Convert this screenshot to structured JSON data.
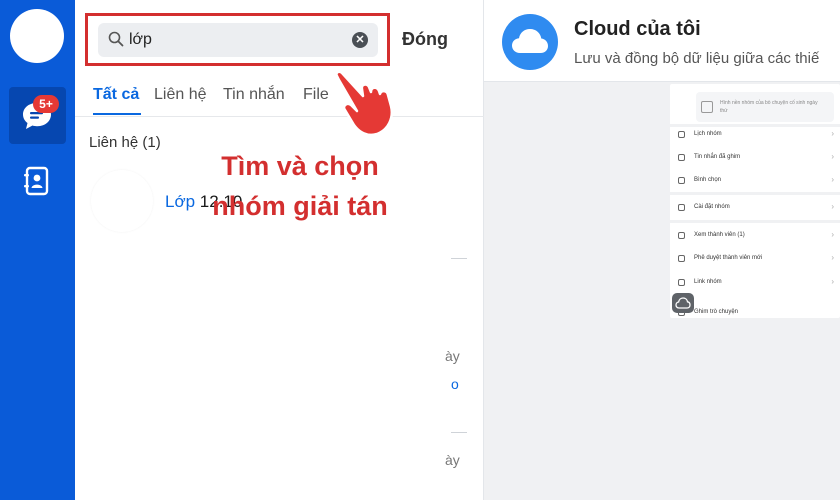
{
  "rail": {
    "chat_badge": "5+"
  },
  "search": {
    "value": "lớp",
    "placeholder": ""
  },
  "header": {
    "close_label": "Đóng"
  },
  "tabs": [
    {
      "label": "Tất cả",
      "active": true
    },
    {
      "label": "Liên hệ",
      "active": false
    },
    {
      "label": "Tin nhắn",
      "active": false
    },
    {
      "label": "File",
      "active": false
    }
  ],
  "results": {
    "section_title": "Liên hệ (1)",
    "item": {
      "name_highlight": "Lớp",
      "name_rest": " 12.10"
    }
  },
  "ghost_text": {
    "line1": "ày",
    "line2": "o",
    "line3": "ày"
  },
  "annotation": {
    "line1": "Tìm và chọn",
    "line2": "nhóm giải tán"
  },
  "cloud": {
    "title": "Cloud của tôi",
    "subtitle": "Lưu và đồng bộ dữ liệu giữa các thiế"
  },
  "phone": {
    "note_text": "Hình nền nhóm của bò chuyện cố sinh ngày thứ",
    "rows": [
      "Lịch nhóm",
      "Tin nhắn đã ghim",
      "Bình chọn",
      "Cài đặt nhóm",
      "Xem thành viên (1)",
      "Phê duyệt thành viên mới",
      "Link nhóm",
      "Ghim trò chuyện"
    ],
    "link_sub": "https://zalo.me/g/..."
  },
  "colors": {
    "rail": "#0a5bd8",
    "accent": "#0a68e0",
    "annotation": "#d32f2f",
    "badge": "#e53935"
  }
}
